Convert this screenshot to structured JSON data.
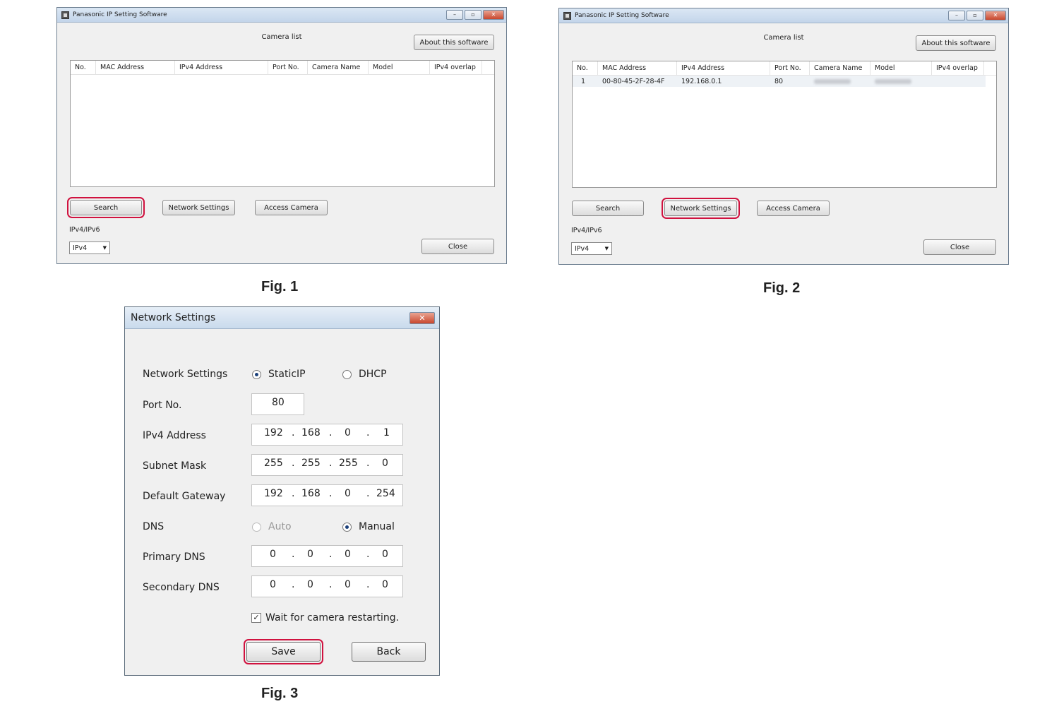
{
  "camera_window": {
    "title": "Panasonic IP Setting Software",
    "list_title": "Camera list",
    "about_label": "About this software",
    "columns": [
      "No.",
      "MAC Address",
      "IPv4 Address",
      "Port No.",
      "Camera Name",
      "Model",
      "IPv4 overlap"
    ],
    "search_label": "Search",
    "network_settings_label": "Network Settings",
    "access_camera_label": "Access Camera",
    "ip_version_label": "IPv4/IPv6",
    "ip_version_value": "IPv4",
    "close_label": "Close",
    "rows_fig2": [
      {
        "no": "1",
        "mac": "00-80-45-2F-28-4F",
        "ipv4": "192.168.0.1",
        "port": "80"
      }
    ]
  },
  "figures": {
    "fig1": "Fig. 1",
    "fig2": "Fig. 2",
    "fig3": "Fig. 3"
  },
  "network_dialog": {
    "title": "Network Settings",
    "close_glyph": "✕",
    "network_settings_label": "Network Settings",
    "static_ip_label": "StaticIP",
    "dhcp_label": "DHCP",
    "port_label": "Port No.",
    "port_value": "80",
    "ipv4_label": "IPv4 Address",
    "ipv4": [
      "192",
      "168",
      "0",
      "1"
    ],
    "subnet_label": "Subnet Mask",
    "subnet": [
      "255",
      "255",
      "255",
      "0"
    ],
    "gateway_label": "Default Gateway",
    "gateway": [
      "192",
      "168",
      "0",
      "254"
    ],
    "dns_label": "DNS",
    "dns_auto_label": "Auto",
    "dns_manual_label": "Manual",
    "primary_dns_label": "Primary DNS",
    "primary_dns": [
      "0",
      "0",
      "0",
      "0"
    ],
    "secondary_dns_label": "Secondary DNS",
    "secondary_dns": [
      "0",
      "0",
      "0",
      "0"
    ],
    "wait_label": "Wait for camera restarting.",
    "save_label": "Save",
    "back_label": "Back"
  },
  "colors": {
    "highlight": "#d0123f",
    "titlebar": "#c3d5ea"
  }
}
